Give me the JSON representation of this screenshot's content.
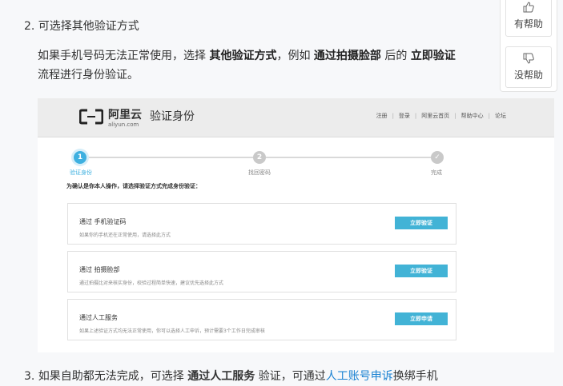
{
  "step2": {
    "title": "2. 可选择其他验证方式",
    "para_line1_prefix": "如果手机号码无法正常使用，选择 ",
    "bold_other": "其他验证方式",
    "para_line1_mid": "，例如 ",
    "bold_photo": "通过拍摄脸部",
    "para_line1_mid2": " 后的 ",
    "bold_verify_now": "立即验证",
    "para_line2": "流程进行身份验证。"
  },
  "feedback": {
    "helpful_label": "有帮助",
    "helpful_icon": "thumbs-up-icon",
    "unhelpful_label": "没帮助",
    "unhelpful_icon": "thumbs-down-icon"
  },
  "embedded": {
    "logo_cn": "阿里云",
    "logo_en": "aliyun.com",
    "header_title": "验证身份",
    "nav": [
      "注册",
      "登录",
      "阿里云首页",
      "帮助中心",
      "论坛"
    ],
    "steps": [
      {
        "num": "1",
        "label": "验证身份",
        "active": true
      },
      {
        "num": "2",
        "label": "找回密码",
        "active": false
      },
      {
        "num": "✓",
        "label": "完成",
        "active": false
      }
    ],
    "instruction": "为确认是你本人操作，请选择验证方式完成身份验证：",
    "options": [
      {
        "title": "通过 手机验证码",
        "desc": "如果你的手机还在正常使用，请选择此方式",
        "button": "立即验证"
      },
      {
        "title": "通过 拍摄脸部",
        "desc": "通过拍摄比对来核实身份，校验过程简单快速，建议优先选择此方式",
        "button": "立即验证"
      },
      {
        "title": "通过人工服务",
        "desc": "如果上述验证方式均无法正常使用，你可以选择人工申诉，预计需要3个工作日完成审核",
        "button": "立即申请"
      }
    ],
    "accent_color": "#42b3d6"
  },
  "step3": {
    "prefix": "3. 如果自助都无法完成，可选择 ",
    "bold_manual": "通过人工服务",
    "mid": " 验证，可通过",
    "link": "人工账号申诉",
    "suffix": "换绑手机"
  }
}
